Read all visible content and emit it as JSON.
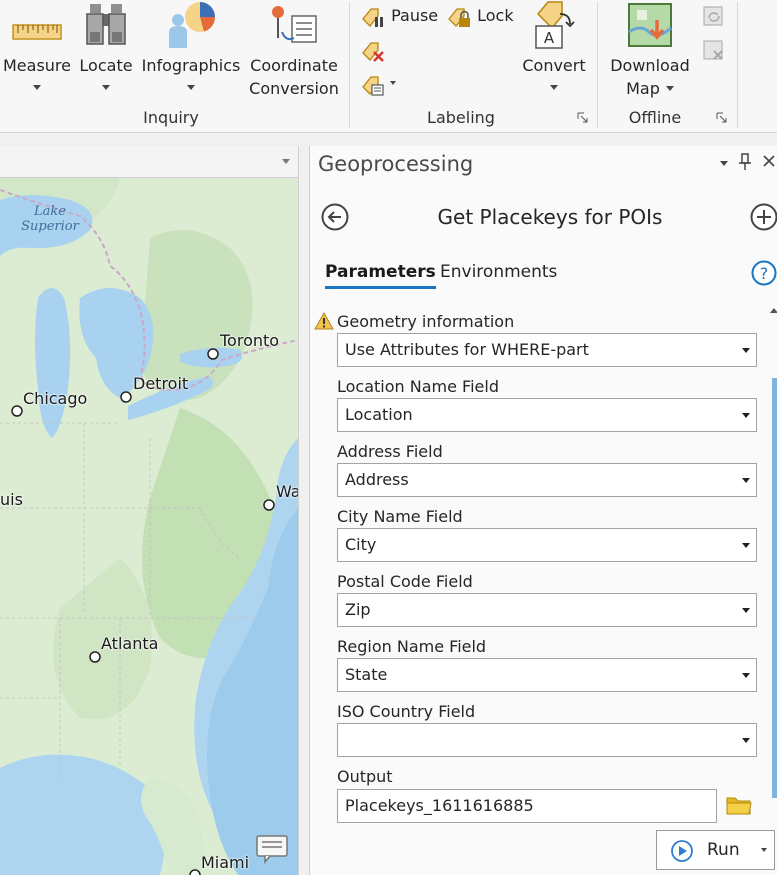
{
  "ribbon": {
    "buttons": [
      {
        "id": "measure",
        "label": "Measure"
      },
      {
        "id": "locate",
        "label": "Locate"
      },
      {
        "id": "infographics",
        "label": "Infographics"
      },
      {
        "id": "coordinate_line1",
        "label": "Coordinate"
      },
      {
        "id": "coordinate_line2",
        "label": "Conversion"
      }
    ],
    "groups": {
      "inquiry": "Inquiry",
      "labeling": "Labeling",
      "offline": "Offline"
    },
    "labeling": {
      "pause": "Pause",
      "lock": "Lock",
      "convert": "Convert"
    },
    "offline": {
      "download_line1": "Download",
      "download_line2": "Map"
    }
  },
  "map": {
    "lake_label_line1": "Lake",
    "lake_label_line2": "Superior",
    "cities": [
      {
        "name": "Toronto"
      },
      {
        "name": "Detroit"
      },
      {
        "name": "Chicago"
      },
      {
        "name": "uis"
      },
      {
        "name": "Wa"
      },
      {
        "name": "Atlanta"
      },
      {
        "name": "Miami"
      }
    ]
  },
  "geoprocessing": {
    "pane_title": "Geoprocessing",
    "tool_title": "Get Placekeys for POIs",
    "tabs": {
      "parameters": "Parameters",
      "environments": "Environments"
    },
    "help": "?",
    "parameters": [
      {
        "label": "Geometry information",
        "value": "Use Attributes for WHERE-part",
        "warning": true
      },
      {
        "label": "Location Name Field",
        "value": "Location"
      },
      {
        "label": "Address Field",
        "value": "Address"
      },
      {
        "label": "City Name Field",
        "value": "City"
      },
      {
        "label": "Postal Code Field",
        "value": "Zip"
      },
      {
        "label": "Region Name Field",
        "value": "State"
      },
      {
        "label": "ISO Country Field",
        "value": ""
      }
    ],
    "output": {
      "label": "Output",
      "value": "Placekeys_1611616885"
    },
    "run_label": "Run"
  },
  "colors": {
    "accent": "#1976c4",
    "warning": "#e8a317",
    "folder": "#d9a400",
    "run_icon": "#2f7fd0"
  }
}
